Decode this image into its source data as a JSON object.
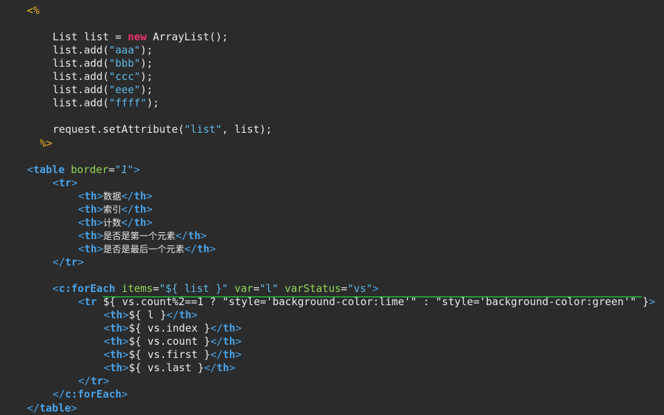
{
  "editor": {
    "lines": [
      {
        "indent": 2,
        "tokens": [
          [
            "delim",
            "<%"
          ]
        ]
      },
      {
        "indent": 0,
        "tokens": []
      },
      {
        "indent": 4,
        "tokens": [
          [
            "squig",
            "List"
          ],
          [
            "default",
            " list = "
          ],
          [
            "kw",
            "new"
          ],
          [
            "default",
            " "
          ],
          [
            "squig",
            "ArrayList"
          ],
          [
            "default",
            "();"
          ]
        ]
      },
      {
        "indent": 4,
        "tokens": [
          [
            "squig",
            "list.add"
          ],
          [
            "default",
            "("
          ],
          [
            "str",
            "\"aaa\""
          ],
          [
            "default",
            ");"
          ]
        ]
      },
      {
        "indent": 4,
        "tokens": [
          [
            "squig",
            "list.add"
          ],
          [
            "default",
            "("
          ],
          [
            "str",
            "\"bbb\""
          ],
          [
            "default",
            ");"
          ]
        ]
      },
      {
        "indent": 4,
        "tokens": [
          [
            "squig",
            "list.add"
          ],
          [
            "default",
            "("
          ],
          [
            "str",
            "\"ccc\""
          ],
          [
            "default",
            ");"
          ]
        ]
      },
      {
        "indent": 4,
        "tokens": [
          [
            "squig",
            "list.add"
          ],
          [
            "default",
            "("
          ],
          [
            "str",
            "\"eee\""
          ],
          [
            "default",
            ");"
          ]
        ]
      },
      {
        "indent": 4,
        "tokens": [
          [
            "squig",
            "list.add"
          ],
          [
            "default",
            "("
          ],
          [
            "str",
            "\"ffff\""
          ],
          [
            "default",
            ");"
          ]
        ]
      },
      {
        "indent": 0,
        "tokens": []
      },
      {
        "indent": 4,
        "tokens": [
          [
            "default",
            "request.setAttribute("
          ],
          [
            "str",
            "\"list\""
          ],
          [
            "default",
            ", list);"
          ]
        ]
      },
      {
        "indent": 3,
        "tokens": [
          [
            "delim",
            "%>"
          ]
        ]
      },
      {
        "indent": 0,
        "tokens": []
      },
      {
        "indent": 2,
        "tokens": [
          [
            "bracket",
            "<"
          ],
          [
            "tag",
            "table"
          ],
          [
            "default",
            " "
          ],
          [
            "attr",
            "border"
          ],
          [
            "default",
            "="
          ],
          [
            "attrval",
            "\"1\""
          ],
          [
            "bracket",
            ">"
          ]
        ]
      },
      {
        "indent": 4,
        "tokens": [
          [
            "bracket",
            "<"
          ],
          [
            "tag",
            "tr"
          ],
          [
            "bracket",
            ">"
          ]
        ]
      },
      {
        "indent": 6,
        "tokens": [
          [
            "bracket",
            "<"
          ],
          [
            "tag",
            "th"
          ],
          [
            "bracket",
            ">"
          ],
          [
            "cjk",
            "数据"
          ],
          [
            "bracket",
            "</"
          ],
          [
            "tag",
            "th"
          ],
          [
            "bracket",
            ">"
          ]
        ]
      },
      {
        "indent": 6,
        "tokens": [
          [
            "bracket",
            "<"
          ],
          [
            "tag",
            "th"
          ],
          [
            "bracket",
            ">"
          ],
          [
            "cjk",
            "索引"
          ],
          [
            "bracket",
            "</"
          ],
          [
            "tag",
            "th"
          ],
          [
            "bracket",
            ">"
          ]
        ]
      },
      {
        "indent": 6,
        "tokens": [
          [
            "bracket",
            "<"
          ],
          [
            "tag",
            "th"
          ],
          [
            "bracket",
            ">"
          ],
          [
            "cjk",
            "计数"
          ],
          [
            "bracket",
            "</"
          ],
          [
            "tag",
            "th"
          ],
          [
            "bracket",
            ">"
          ]
        ]
      },
      {
        "indent": 6,
        "tokens": [
          [
            "bracket",
            "<"
          ],
          [
            "tag",
            "th"
          ],
          [
            "bracket",
            ">"
          ],
          [
            "cjk",
            "是否是第一个元素"
          ],
          [
            "bracket",
            "</"
          ],
          [
            "tag",
            "th"
          ],
          [
            "bracket",
            ">"
          ]
        ]
      },
      {
        "indent": 6,
        "tokens": [
          [
            "bracket",
            "<"
          ],
          [
            "tag",
            "th"
          ],
          [
            "bracket",
            ">"
          ],
          [
            "cjk",
            "是否是最后一个元素"
          ],
          [
            "bracket",
            "</"
          ],
          [
            "tag",
            "th"
          ],
          [
            "bracket",
            ">"
          ]
        ]
      },
      {
        "indent": 4,
        "tokens": [
          [
            "bracket",
            "</"
          ],
          [
            "tag",
            "tr"
          ],
          [
            "bracket",
            ">"
          ]
        ]
      },
      {
        "indent": 0,
        "tokens": []
      },
      {
        "indent": 4,
        "tokens": [
          [
            "bracket",
            "<"
          ],
          [
            "tag",
            "c:forEach"
          ],
          [
            "default",
            " "
          ],
          [
            "attr",
            "items"
          ],
          [
            "default",
            "="
          ],
          [
            "str",
            "\"${ list }\""
          ],
          [
            "default",
            " "
          ],
          [
            "attr",
            "var"
          ],
          [
            "default",
            "="
          ],
          [
            "str",
            "\"l\""
          ],
          [
            "default",
            " "
          ],
          [
            "attr",
            "varStatus"
          ],
          [
            "default",
            "="
          ],
          [
            "str",
            "\"vs\""
          ],
          [
            "bracket",
            ">"
          ]
        ]
      },
      {
        "indent": 6,
        "tokens": [
          [
            "bracket",
            "<"
          ],
          [
            "tag",
            "tr"
          ],
          [
            "default",
            " ${ vs.count%2==1 ? \"style='background-color:lime'\" : \"style='background-color:green'\" }"
          ],
          [
            "bracket",
            ">"
          ]
        ]
      },
      {
        "indent": 8,
        "tokens": [
          [
            "bracket",
            "<"
          ],
          [
            "tag",
            "th"
          ],
          [
            "bracket",
            ">"
          ],
          [
            "el",
            "${ l }"
          ],
          [
            "bracket",
            "</"
          ],
          [
            "tag",
            "th"
          ],
          [
            "bracket",
            ">"
          ]
        ]
      },
      {
        "indent": 8,
        "tokens": [
          [
            "bracket",
            "<"
          ],
          [
            "tag",
            "th"
          ],
          [
            "bracket",
            ">"
          ],
          [
            "el",
            "${ vs.index }"
          ],
          [
            "bracket",
            "</"
          ],
          [
            "tag",
            "th"
          ],
          [
            "bracket",
            ">"
          ]
        ]
      },
      {
        "indent": 8,
        "tokens": [
          [
            "bracket",
            "<"
          ],
          [
            "tag",
            "th"
          ],
          [
            "bracket",
            ">"
          ],
          [
            "el",
            "${ vs.count }"
          ],
          [
            "bracket",
            "</"
          ],
          [
            "tag",
            "th"
          ],
          [
            "bracket",
            ">"
          ]
        ]
      },
      {
        "indent": 8,
        "tokens": [
          [
            "bracket",
            "<"
          ],
          [
            "tag",
            "th"
          ],
          [
            "bracket",
            ">"
          ],
          [
            "el",
            "${ vs.first }"
          ],
          [
            "bracket",
            "</"
          ],
          [
            "tag",
            "th"
          ],
          [
            "bracket",
            ">"
          ]
        ]
      },
      {
        "indent": 8,
        "tokens": [
          [
            "bracket",
            "<"
          ],
          [
            "tag",
            "th"
          ],
          [
            "bracket",
            ">"
          ],
          [
            "el",
            "${ vs.last }"
          ],
          [
            "bracket",
            "</"
          ],
          [
            "tag",
            "th"
          ],
          [
            "bracket",
            ">"
          ]
        ]
      },
      {
        "indent": 6,
        "tokens": [
          [
            "bracket",
            "</"
          ],
          [
            "tag",
            "tr"
          ],
          [
            "bracket",
            ">"
          ]
        ]
      },
      {
        "indent": 4,
        "tokens": [
          [
            "bracket",
            "</"
          ],
          [
            "tag",
            "c:forEach"
          ],
          [
            "bracket",
            ">"
          ]
        ]
      },
      {
        "indent": 2,
        "tokens": [
          [
            "bracket",
            "</"
          ],
          [
            "tag",
            "table"
          ],
          [
            "bracket",
            ">"
          ]
        ]
      }
    ]
  },
  "colors": {
    "background": "#2b2b2b",
    "annotation_underline": "#1f9c3a"
  }
}
